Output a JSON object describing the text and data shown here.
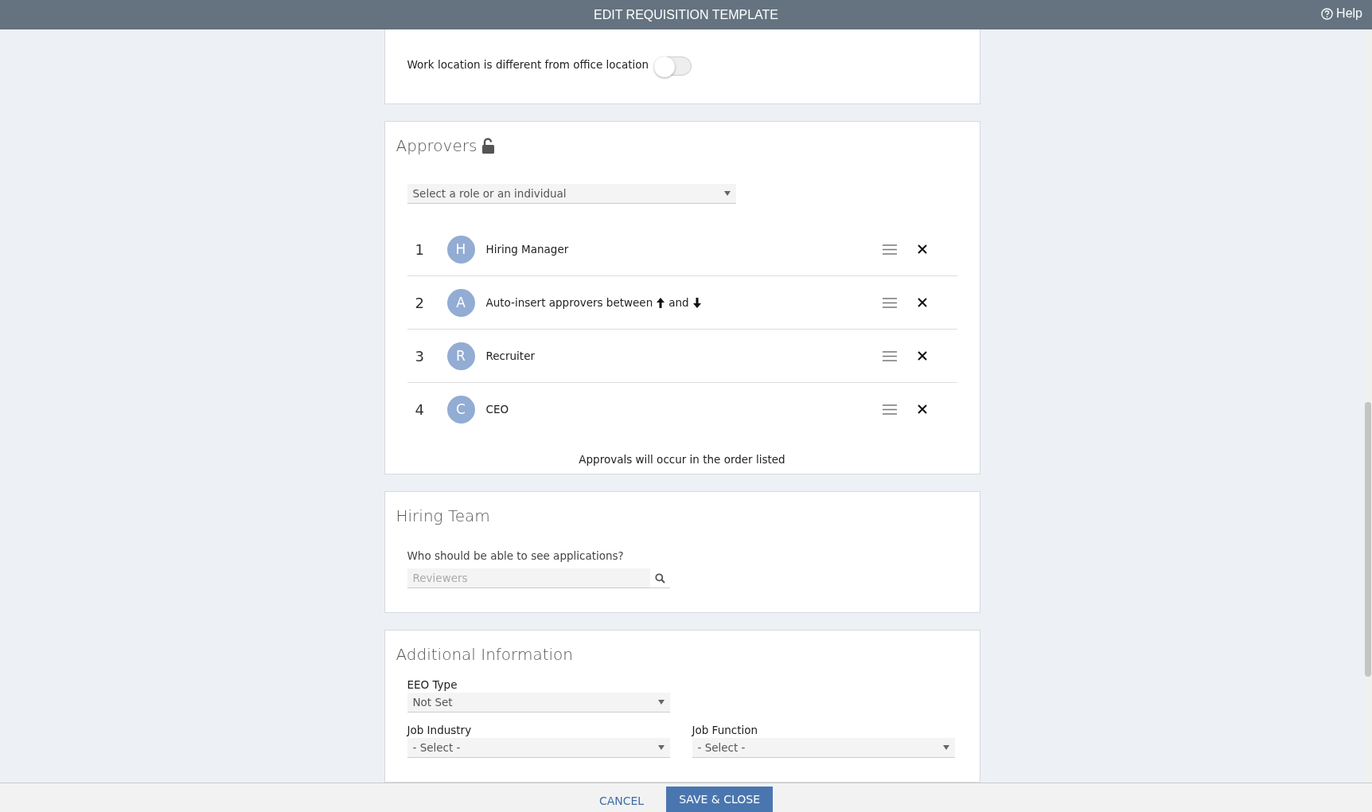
{
  "header": {
    "title": "EDIT REQUISITION TEMPLATE",
    "help": "Help"
  },
  "location": {
    "toggle_label": "Work location is different from office location",
    "on": false
  },
  "approvers": {
    "title": "Approvers",
    "select_placeholder": "Select a role or an individual",
    "items": [
      {
        "kind": "role",
        "number": "1",
        "initial": "H",
        "label": "Hiring Manager"
      },
      {
        "kind": "auto_insert",
        "number": "2",
        "initial": "A",
        "label": "Auto-insert approvers between",
        "between": "and"
      },
      {
        "kind": "role",
        "number": "3",
        "initial": "R",
        "label": "Recruiter"
      },
      {
        "kind": "role",
        "number": "4",
        "initial": "C",
        "label": "CEO"
      }
    ],
    "note": "Approvals will occur in the order listed"
  },
  "hiring_team": {
    "title": "Hiring Team",
    "question": "Who should be able to see applications?",
    "placeholder": "Reviewers"
  },
  "additional": {
    "title": "Additional Information",
    "rows": [
      [
        {
          "label": "EEO Type",
          "value": "Not Set"
        }
      ],
      [
        {
          "label": "Job Industry",
          "value": "- Select -"
        },
        {
          "label": "Job Function",
          "value": "- Select -"
        }
      ]
    ]
  },
  "footer": {
    "cancel": "CANCEL",
    "save": "SAVE & CLOSE"
  }
}
